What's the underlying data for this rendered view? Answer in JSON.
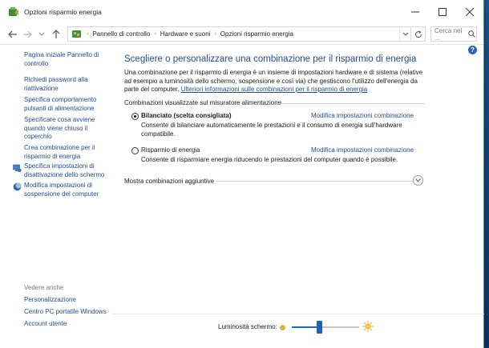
{
  "window": {
    "title": "Opzioni risparmio energia",
    "controls": {
      "minimize_icon": "minimize-icon",
      "maximize_icon": "maximize-icon",
      "close_icon": "close-icon"
    }
  },
  "address_bar": {
    "breadcrumbs": [
      "Pannello di controllo",
      "Hardware e suoni",
      "Opzioni risparmio energia"
    ],
    "search_placeholder": "Cerca nel ..."
  },
  "left_pane": {
    "links": [
      "Pagina iniziale Pannello di controllo",
      "Richiedi password alla riattivazione",
      "Specifica comportamento pulsanti di alimentazione",
      "Specificare cosa avviene quando viene chiuso il coperchio",
      "Crea combinazione per il risparmio di energia",
      "Specifica impostazioni di disattivazione dello schermo",
      "Modifica impostazioni di sospensione del computer"
    ],
    "see_also_label": "Vedere anche",
    "see_also_links": [
      "Personalizzazione",
      "Centro PC portatile Windows",
      "Account utente"
    ]
  },
  "main": {
    "heading": "Scegliere o personalizzare una combinazione per il risparmio di energia",
    "description": "Una combinazione per il risparmio di energia è un insieme di impostazioni hardware e di sistema (relative ad esempio a luminosità dello schermo, sospensione e così via) che gestiscono l'utilizzo dell'energia da parte del computer. ",
    "description_link": "Ulteriori informazioni sulle combinazioni per il risparmio di energia",
    "group_label": "Combinazioni visualizzate sul misuratore alimentazione",
    "plans": [
      {
        "name": "Bilanciato (scelta consigliata)",
        "selected": true,
        "modify_label": "Modifica impostazioni combinazione",
        "description": "Consente di bilanciare automaticamente le prestazioni e il consumo di energia sull'hardware compatibile."
      },
      {
        "name": "Risparmio di energia",
        "selected": false,
        "modify_label": "Modifica impostazioni combinazione",
        "description": "Consente di risparmiare energia riducendo le prestazioni del computer quando è possibile."
      }
    ],
    "more_plans_label": "Mostra combinazioni aggiuntive"
  },
  "brightness": {
    "label": "Luminosità schermo:",
    "level_fraction": 0.4
  },
  "colors": {
    "link": "#1f4c8e",
    "accent": "#2c63b0"
  }
}
